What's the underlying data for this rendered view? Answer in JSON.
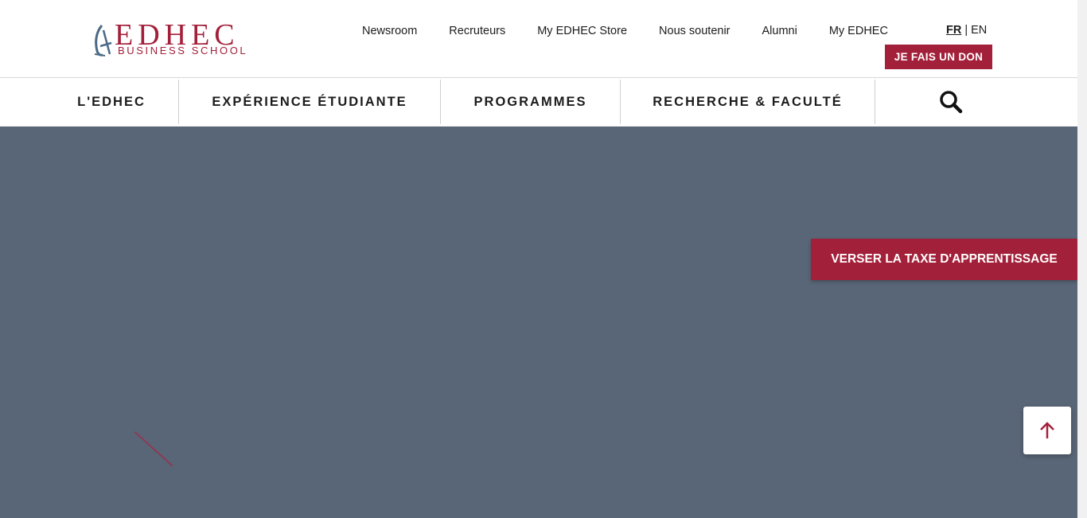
{
  "brand": {
    "wordmark": "EDHEC",
    "sub": "BUSINESS SCHOOL",
    "color": "#a3203a"
  },
  "utility_nav": {
    "items": [
      "Newsroom",
      "Recruteurs",
      "My EDHEC Store",
      "Nous soutenir",
      "Alumni",
      "My EDHEC"
    ]
  },
  "language": {
    "active": "FR",
    "separator": "|",
    "other": "EN"
  },
  "donate_label": "JE FAIS UN DON",
  "main_nav": {
    "items": [
      "L'EDHEC",
      "EXPÉRIENCE ÉTUDIANTE",
      "PROGRAMMES",
      "RECHERCHE & FACULTÉ"
    ],
    "search_icon": "search-icon"
  },
  "hero": {
    "background": "#596677",
    "cta_label": "VERSER LA TAXE D'APPRENTISSAGE"
  },
  "back_to_top_icon": "arrow-up-icon"
}
